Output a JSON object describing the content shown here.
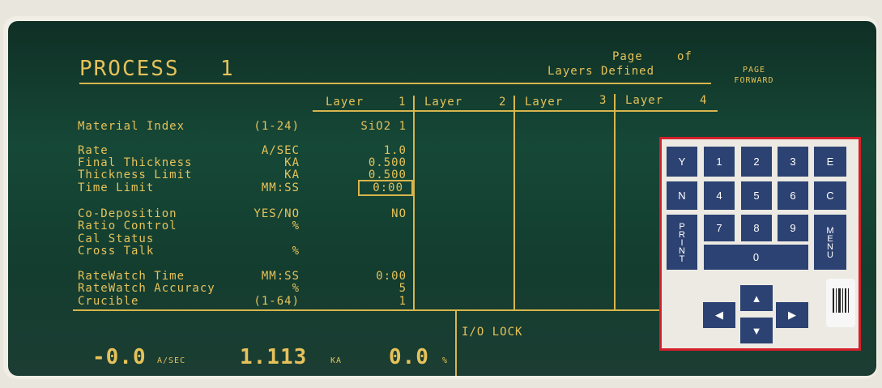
{
  "header": {
    "title": "PROCESS",
    "process_no": "1",
    "page_label": "Page",
    "of_label": "of",
    "layers_defined": "Layers Defined",
    "page_forward": "PAGE FORWARD"
  },
  "columns": [
    {
      "label": "Layer",
      "num": "1"
    },
    {
      "label": "Layer",
      "num": "2"
    },
    {
      "label": "Layer",
      "num": "3"
    },
    {
      "label": "Layer",
      "num": "4"
    }
  ],
  "rows": [
    {
      "label": "Material Index",
      "unit": "(1-24)",
      "value": "SiO2   1"
    },
    {
      "label": "Rate",
      "unit": "A/SEC",
      "value": "1.0"
    },
    {
      "label": "Final Thickness",
      "unit": "KA",
      "value": "0.500"
    },
    {
      "label": "Thickness Limit",
      "unit": "KA",
      "value": "0.500"
    },
    {
      "label": "Time Limit",
      "unit": "MM:SS",
      "value": "0:00"
    },
    {
      "label": "Co-Deposition",
      "unit": "YES/NO",
      "value": "NO"
    },
    {
      "label": "Ratio Control",
      "unit": "%",
      "value": ""
    },
    {
      "label": "Cal Status",
      "unit": "",
      "value": ""
    },
    {
      "label": "Cross Talk",
      "unit": "%",
      "value": ""
    },
    {
      "label": "RateWatch Time",
      "unit": "MM:SS",
      "value": "0:00"
    },
    {
      "label": "RateWatch Accuracy",
      "unit": "%",
      "value": "5"
    },
    {
      "label": "Crucible",
      "unit": "(1-64)",
      "value": "1"
    }
  ],
  "status": {
    "rate_value": "-0.0",
    "rate_unit": "A/SEC",
    "thickness_value": "1.113",
    "thickness_unit": "KA",
    "power_value": "0.0",
    "power_unit": "%",
    "io_lock": "I/O LOCK"
  },
  "keypad": {
    "y": "Y",
    "n": "N",
    "e": "E",
    "c": "C",
    "k1": "1",
    "k2": "2",
    "k3": "3",
    "k4": "4",
    "k5": "5",
    "k6": "6",
    "k7": "7",
    "k8": "8",
    "k9": "9",
    "k0": "0",
    "print": "PRINT",
    "menu": "MENU",
    "up": "▲",
    "down": "▼",
    "left": "◀",
    "right": "▶"
  },
  "colors": {
    "display_text": "#e6c25a",
    "keypad_border": "#d3202a",
    "key_fill": "#2c4272"
  }
}
